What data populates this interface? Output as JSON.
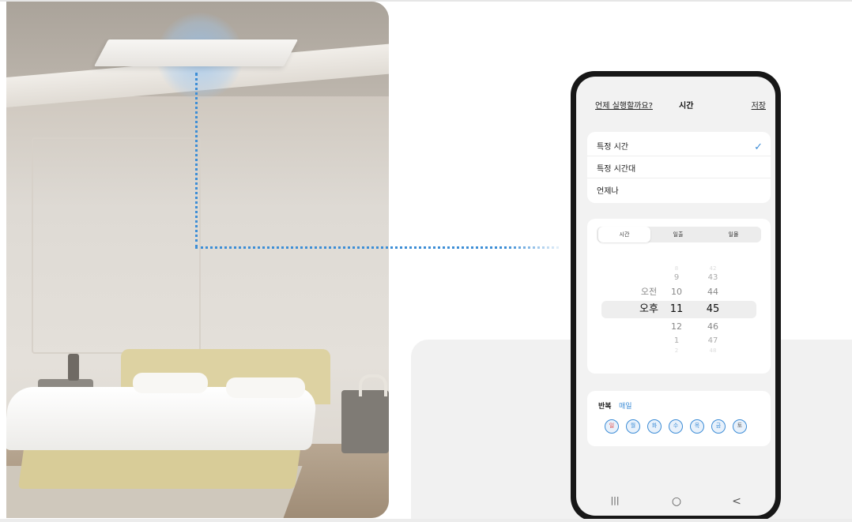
{
  "phone": {
    "header": {
      "question": "언제 실행할까요?",
      "title": "시간",
      "save": "저장"
    },
    "options": [
      {
        "label": "특정 시간",
        "selected": true
      },
      {
        "label": "특정 시간대",
        "selected": false
      },
      {
        "label": "언제나",
        "selected": false
      }
    ],
    "check_icon": "✓",
    "segments": [
      {
        "label": "시간",
        "active": true
      },
      {
        "label": "일출",
        "active": false
      },
      {
        "label": "일몰",
        "active": false
      }
    ],
    "picker": {
      "ampm": [
        "오전",
        "오후"
      ],
      "hours": [
        "8",
        "9",
        "10",
        "11",
        "12",
        "1",
        "2"
      ],
      "minutes": [
        "42",
        "43",
        "44",
        "45",
        "46",
        "47",
        "48"
      ],
      "selected": {
        "ampm": "오후",
        "hour": "11",
        "minute": "45"
      }
    },
    "repeat": {
      "label": "반복",
      "value": "매일",
      "days": [
        "일",
        "월",
        "화",
        "수",
        "목",
        "금",
        "토"
      ]
    },
    "nav": {
      "recent": "|||",
      "home": "○",
      "back": "<"
    }
  },
  "colors": {
    "accent": "#3c8cd6",
    "connector": "#3d8ed6",
    "sunday": "#e04a4a"
  }
}
